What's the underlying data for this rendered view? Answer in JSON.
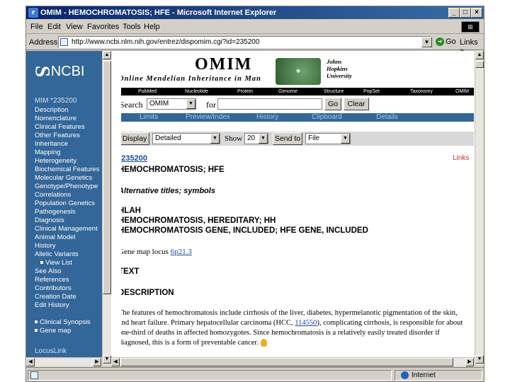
{
  "window": {
    "title": "OMIM - HEMOCHROMATOSIS; HFE - Microsoft Internet Explorer",
    "min_glyph": "_",
    "max_glyph": "□",
    "close_glyph": "×"
  },
  "menu": [
    "File",
    "Edit",
    "View",
    "Favorites",
    "Tools",
    "Help"
  ],
  "address": {
    "label": "Address",
    "url": "http://www.ncbi.nlm.nih.gov/entrez/dispomim.cgi?id=235200",
    "go_label": "Go",
    "links_label": "Links »"
  },
  "sidebar": {
    "logo_text": "NCBI",
    "mim_label": "MIM *235200",
    "items": [
      "Description",
      "Nomenclature",
      "Clinical Features",
      "Other Features",
      "Inheritance",
      "Mapping",
      "Heterogeneity",
      "Biochemical Features",
      "Molecular Genetics",
      "Genotype/Phenotype",
      "Correlations",
      "Population Genetics",
      "Pathogenesis",
      "Diagnosis",
      "Clinical Management",
      "Animal Model",
      "History",
      "Allelic Variants"
    ],
    "view_list": "View List",
    "items2": [
      "See Also",
      "References",
      "Contributors",
      "Creation Date",
      "Edit History"
    ],
    "clinical_synopsis": "Clinical Synopsis",
    "gene_map": "Gene map",
    "locuslink": "LocusLink"
  },
  "header": {
    "title": "OMIM",
    "subtitle": "Online Mendelian Inheritance in Man",
    "jhu": [
      "Johns",
      "Hopkins",
      "University"
    ]
  },
  "db_bar": [
    "PubMed",
    "Nucleotide",
    "Protein",
    "Genome",
    "Structure",
    "PopSet",
    "Taxonomy",
    "OMIM"
  ],
  "search": {
    "label": "Search",
    "db_value": "OMIM",
    "for_label": "for",
    "query": "",
    "go": "Go",
    "clear": "Clear"
  },
  "tabs": [
    "Limits",
    "Preview/Index",
    "History",
    "Clipboard",
    "Details"
  ],
  "display": {
    "display_btn": "Display",
    "format": "Detailed",
    "show_label": "Show",
    "show_value": "20",
    "send_btn": "Send to",
    "send_value": "File"
  },
  "record": {
    "mim_number": "*235200",
    "links": "Links",
    "title": "HEMOCHROMATOSIS; HFE",
    "alt_titles": "Alternative titles; symbols",
    "alt1": "HLAH",
    "alt2": "HEMOCHROMATOSIS, HEREDITARY; HH",
    "alt3": "HEMOCHROMATOSIS GENE, INCLUDED; HFE GENE, INCLUDED",
    "gene_map_label": "Gene map locus",
    "gene_map_locus": "6p21.3",
    "text_heading": "TEXT",
    "description_heading": "DESCRIPTION",
    "para_part1": "The features of hemochromatosis include cirrhosis of the liver, diabetes, hypermelanotic pigmentation of the skin, and heart failure. Primary hepatocellular carcinoma (HCC,",
    "para_link": "114550",
    "para_part2": "), complicating cirrhosis, is responsible for about one-third of deaths in affected homozygotes. Since hemochromatosis is a relatively easily treated disorder if diagnosed, this is a form of preventable cancer."
  },
  "status": {
    "zone": "Internet"
  }
}
